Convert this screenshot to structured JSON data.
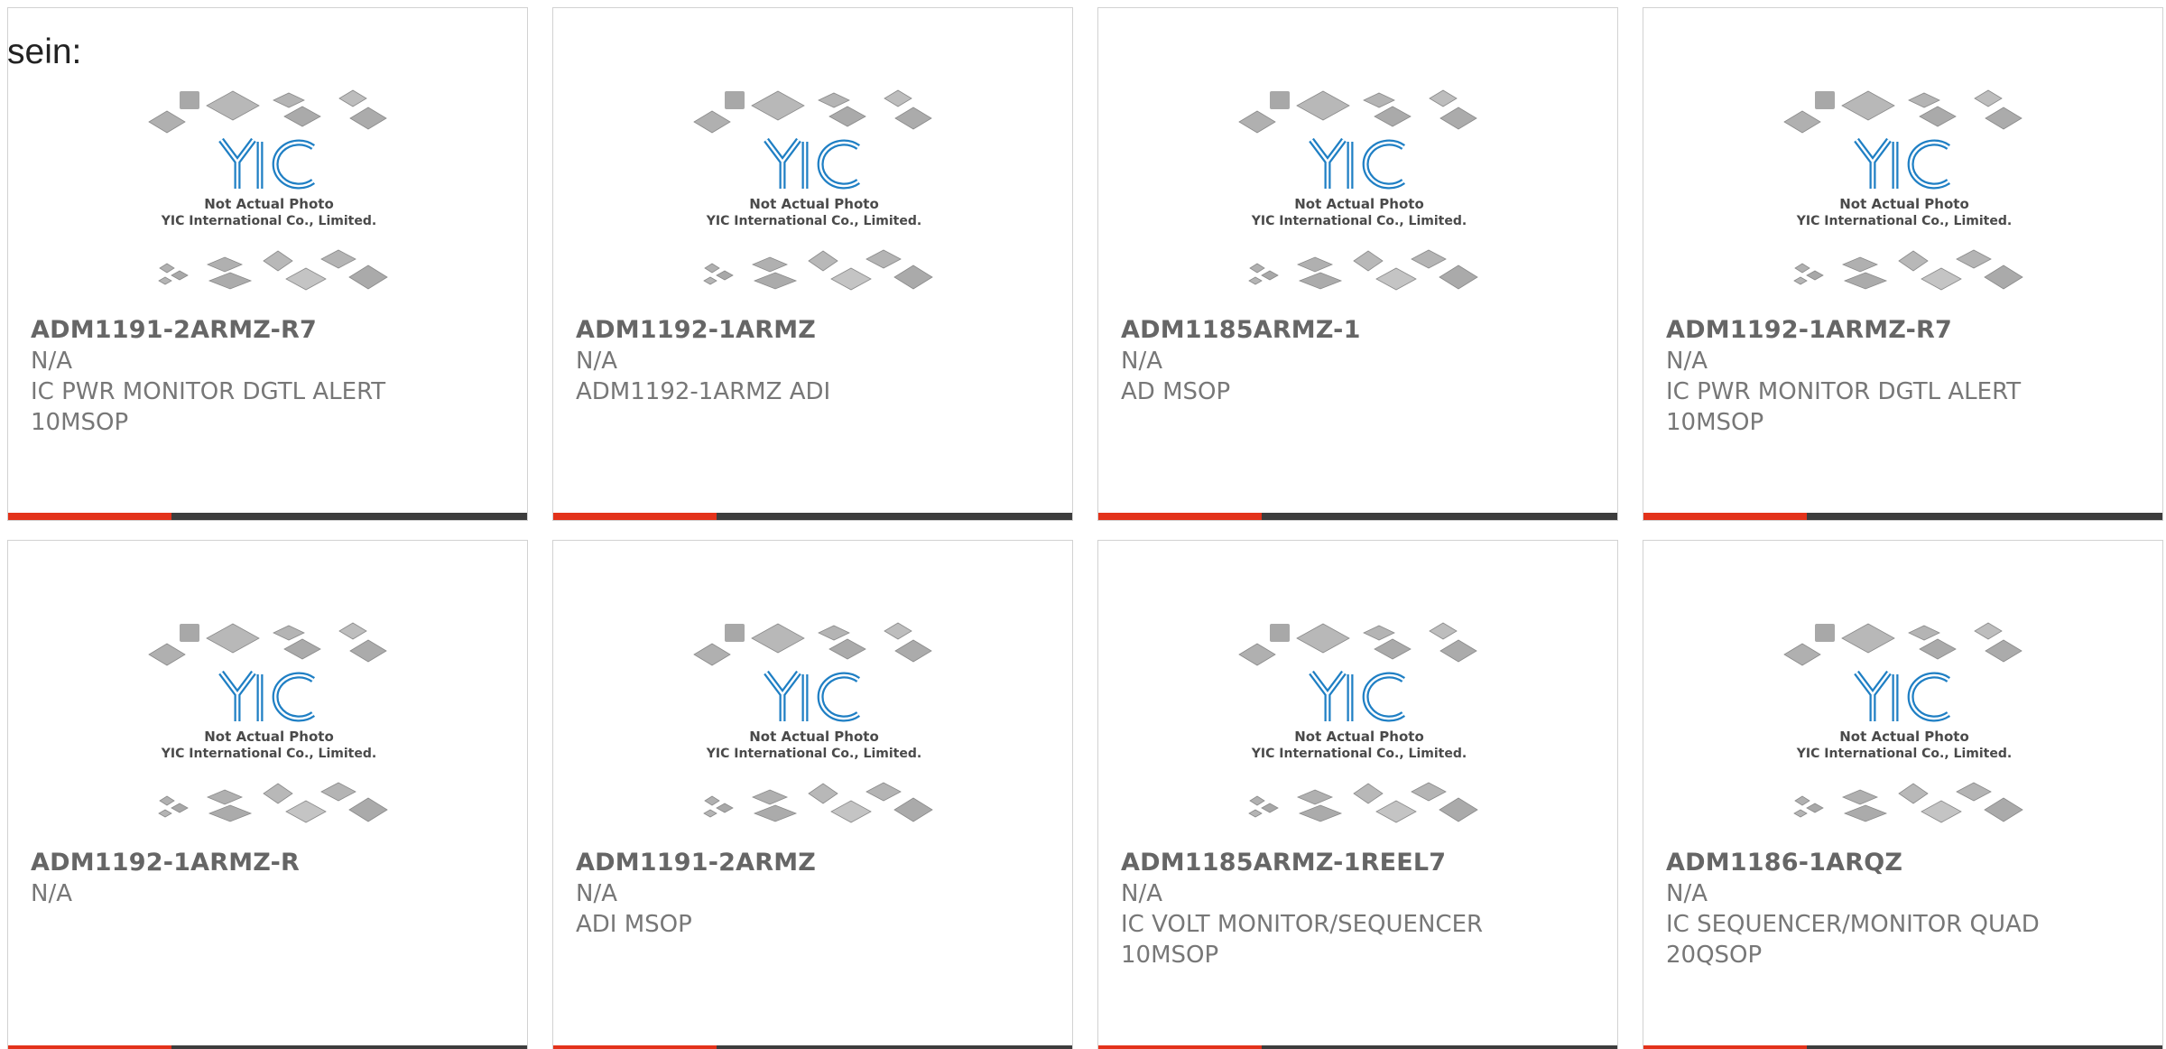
{
  "lead_text": "sein:",
  "placeholder": {
    "caption_line1": "Not Actual Photo",
    "caption_line2": "YIC International Co., Limited.",
    "brand": "YIC"
  },
  "colors": {
    "accent": "#e3321a",
    "bar": "#3d3d3d",
    "brand_blue": "#1f7fc4",
    "text": "#777777"
  },
  "products": [
    {
      "part": "ADM1191-2ARMZ-R7",
      "manufacturer": "N/A",
      "description": "IC PWR MONITOR DGTL ALERT 10MSOP"
    },
    {
      "part": "ADM1192-1ARMZ",
      "manufacturer": "N/A",
      "description": "ADM1192-1ARMZ ADI"
    },
    {
      "part": "ADM1185ARMZ-1",
      "manufacturer": "N/A",
      "description": "AD MSOP"
    },
    {
      "part": "ADM1192-1ARMZ-R7",
      "manufacturer": "N/A",
      "description": "IC PWR MONITOR DGTL ALERT 10MSOP"
    },
    {
      "part": "ADM1192-1ARMZ-R",
      "manufacturer": "N/A",
      "description": ""
    },
    {
      "part": "ADM1191-2ARMZ",
      "manufacturer": "N/A",
      "description": "ADI MSOP"
    },
    {
      "part": "ADM1185ARMZ-1REEL7",
      "manufacturer": "N/A",
      "description": "IC VOLT MONITOR/SEQUENCER 10MSOP"
    },
    {
      "part": "ADM1186-1ARQZ",
      "manufacturer": "N/A",
      "description": "IC SEQUENCER/MONITOR QUAD 20QSOP"
    }
  ]
}
